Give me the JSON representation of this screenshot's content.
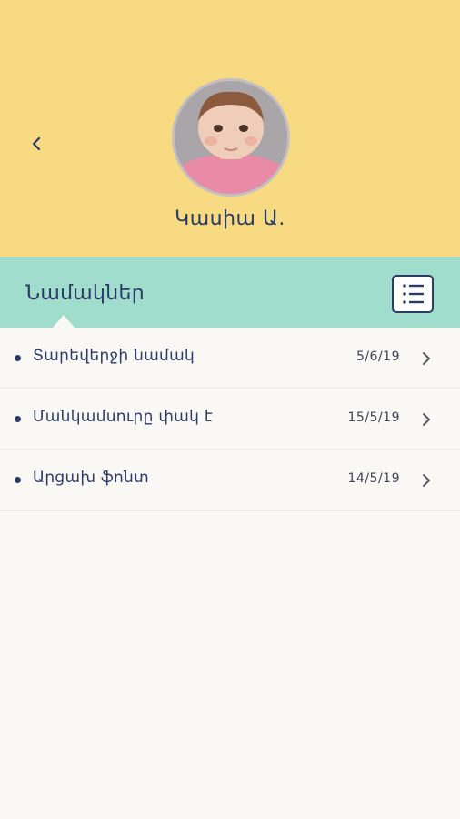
{
  "profile": {
    "name": "Կասիա Ա."
  },
  "section": {
    "title": "Նամակներ"
  },
  "messages": [
    {
      "title": "Տարեվերջի նամակ",
      "date": "5/6/19"
    },
    {
      "title": "Մանկամսուրը փակ է",
      "date": "15/5/19"
    },
    {
      "title": "Արցախ ֆոնտ",
      "date": "14/5/19"
    }
  ],
  "icons": {
    "back": "chevron-left-icon",
    "list": "list-icon",
    "row": "chevron-right-icon"
  },
  "colors": {
    "header_bg": "#f7da82",
    "tab_bg": "#a0ddcc",
    "text": "#2c3b66",
    "body_bg": "#faf8f5"
  }
}
